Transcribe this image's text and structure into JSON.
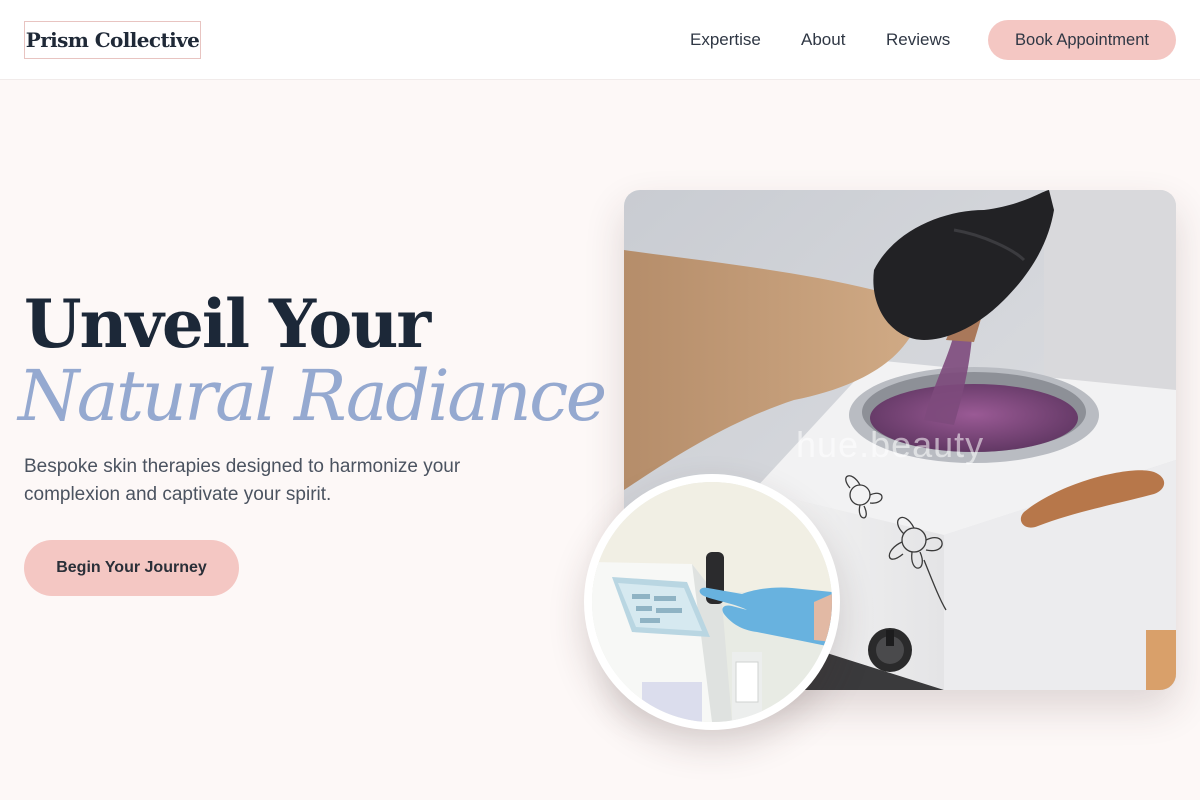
{
  "header": {
    "logo": "Prism Collective",
    "nav": {
      "expertise": "Expertise",
      "about": "About",
      "reviews": "Reviews"
    },
    "cta_label": "Book Appointment"
  },
  "hero": {
    "title_line1": "Unveil Your",
    "title_line2": "Natural Radiance",
    "subtitle": "Bespoke skin therapies designed to harmonize your complexion and captivate your spirit.",
    "cta_label": "Begin Your Journey"
  },
  "images": {
    "main_watermark": "hue.beauty"
  },
  "colors": {
    "accent_pink": "#f4c7c3",
    "accent_blue": "#95a9d0",
    "heading_dark": "#1c2838",
    "background": "#fdf8f7"
  }
}
